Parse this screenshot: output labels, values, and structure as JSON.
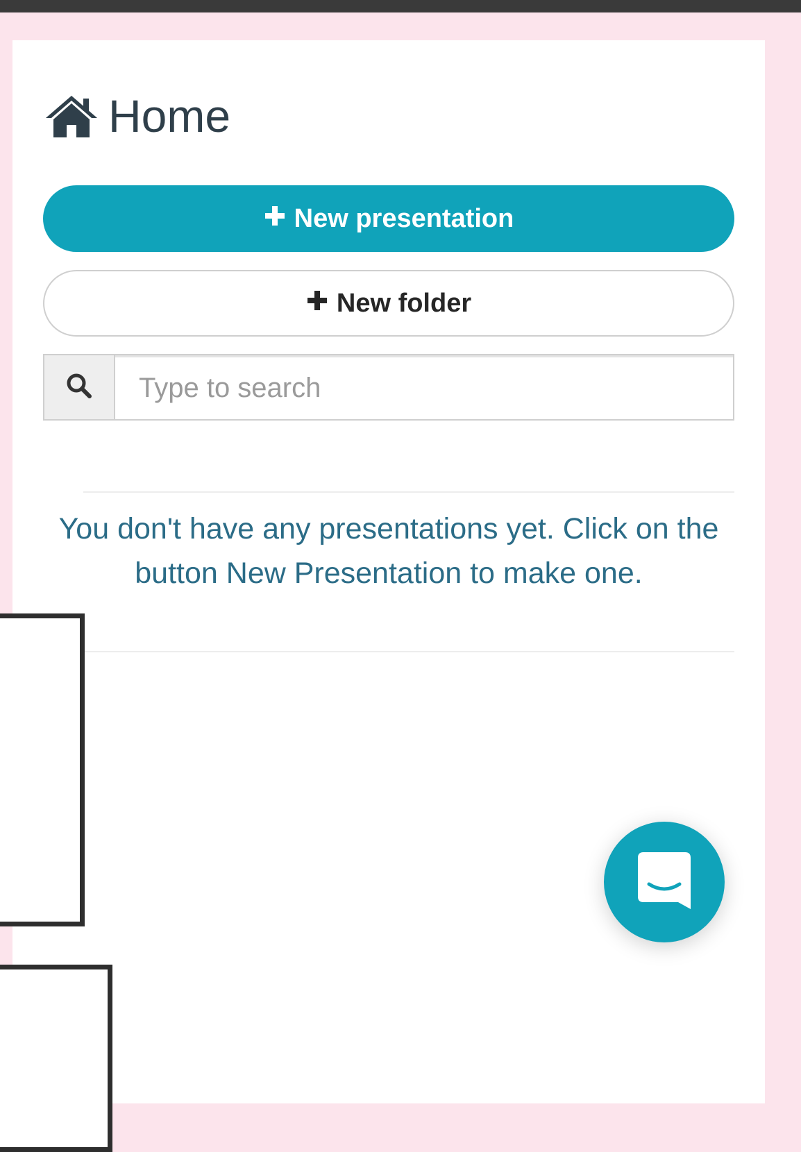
{
  "header": {
    "title": "Home",
    "icon": "home-icon"
  },
  "actions": {
    "new_presentation_label": "New presentation",
    "new_folder_label": "New folder"
  },
  "search": {
    "placeholder": "Type to search",
    "value": "",
    "icon": "search-icon"
  },
  "empty_state": {
    "message": "You don't have any presentations yet. Click on the button New Presentation to make one."
  },
  "chat": {
    "icon": "chat-bubble-icon"
  },
  "colors": {
    "accent": "#10a3ba",
    "page_background": "#fce4ec",
    "text_dark": "#2f3f4a",
    "message_text": "#2b6c87"
  }
}
